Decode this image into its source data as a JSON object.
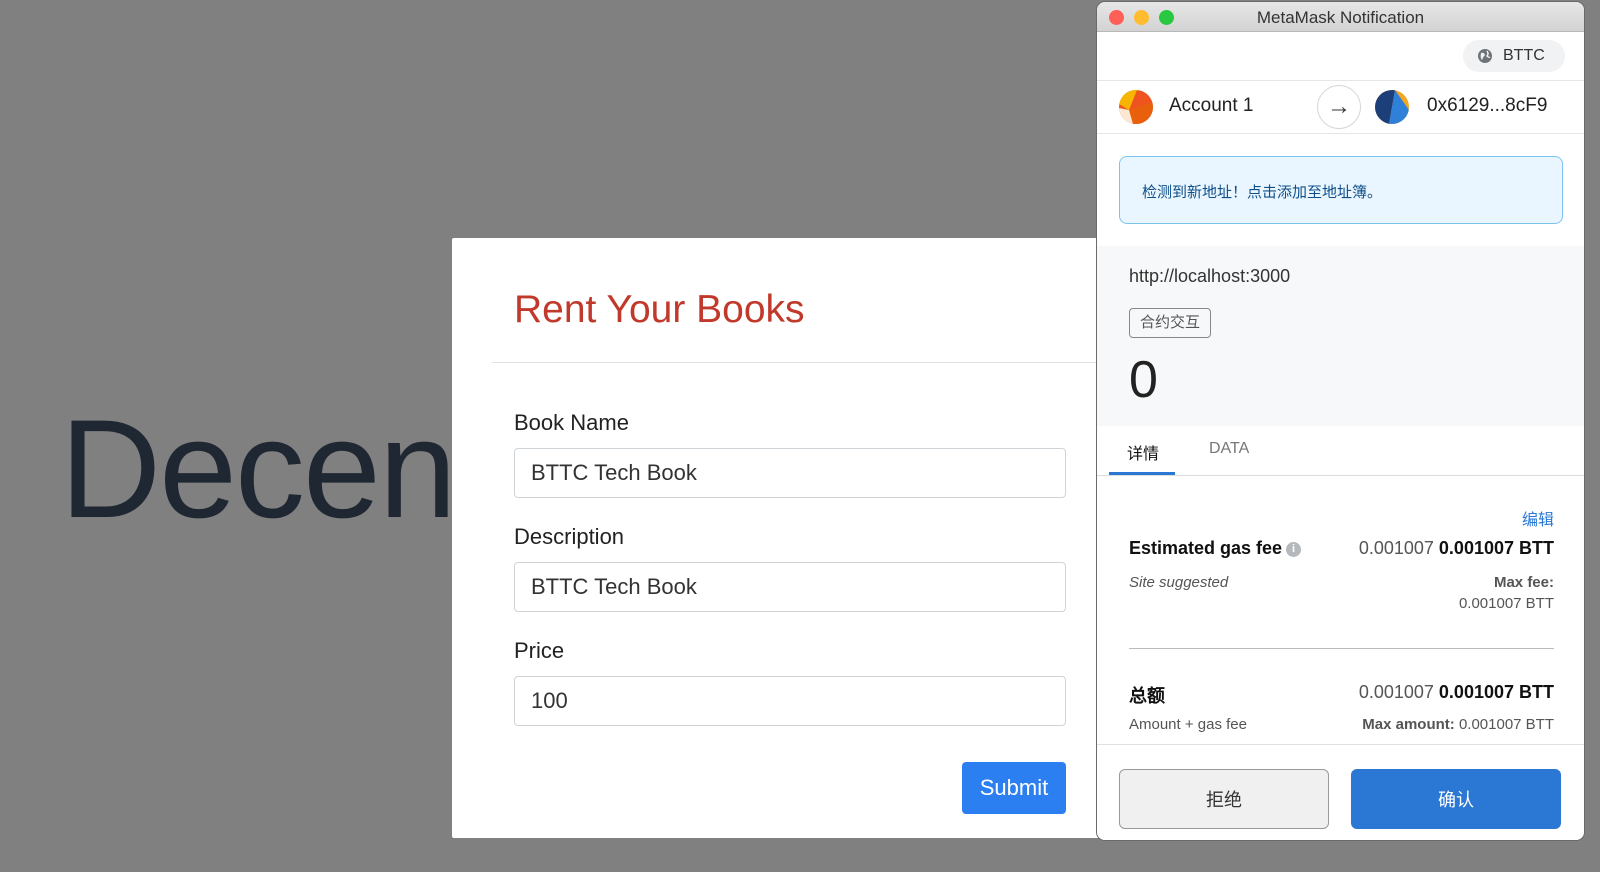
{
  "background": {
    "heading": "Decent"
  },
  "modal": {
    "title": "Rent Your Books",
    "fields": [
      {
        "label": "Book Name",
        "value": "BTTC Tech Book"
      },
      {
        "label": "Description",
        "value": "BTTC Tech Book"
      },
      {
        "label": "Price",
        "value": "100"
      }
    ],
    "submit_label": "Submit"
  },
  "metamask": {
    "window_title": "MetaMask Notification",
    "network": "BTTC",
    "from_account": "Account 1",
    "to_address": "0x6129...8cF9",
    "notice": "检测到新地址！点击添加至地址簿。",
    "origin": "http://localhost:3000",
    "tag": "合约交互",
    "amount": "0",
    "tabs": {
      "details": "详情",
      "data": "DATA"
    },
    "edit_label": "编辑",
    "gas": {
      "label": "Estimated gas fee",
      "value_plain": "0.001007",
      "value_bold": "0.001007 BTT",
      "sub_left": "Site suggested",
      "max_fee_label": "Max fee:",
      "max_fee_value": "0.001007 BTT"
    },
    "total": {
      "label": "总额",
      "value_plain": "0.001007",
      "value_bold": "0.001007 BTT",
      "sub_left": "Amount + gas fee",
      "max_amount_label": "Max amount:",
      "max_amount_value": "0.001007 BTT"
    },
    "reject_label": "拒绝",
    "confirm_label": "确认"
  },
  "colors": {
    "accent_blue": "#2a78d4",
    "submit_blue": "#2b7ff0",
    "modal_title_red": "#c0392b"
  }
}
